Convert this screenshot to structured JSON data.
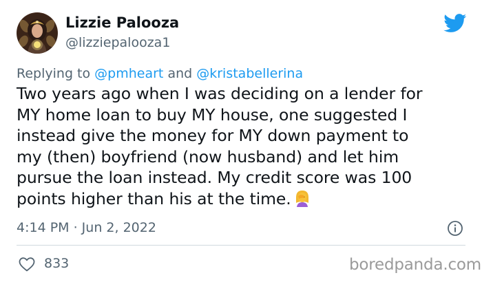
{
  "author": {
    "display_name": "Lizzie Palooza",
    "handle": "@lizziepalooza1",
    "avatar_icon": "profile-avatar"
  },
  "platform_icon": "twitter-bird-icon",
  "reply_context": {
    "prefix": "Replying to",
    "mention_1": "@pmheart",
    "joiner": "and",
    "mention_2": "@kristabellerina"
  },
  "tweet": {
    "lines": [
      "Two years ago when I was deciding on a lender for",
      "MY home loan to buy MY house, one suggested I",
      "instead give the money for MY down payment to",
      "my (then) boyfriend (now husband) and let him",
      "pursue the loan instead. My credit score was 100",
      "points higher than his at the time."
    ],
    "emoji": "woman-facepalming-emoji"
  },
  "meta": {
    "timestamp": "4:14 PM · Jun 2, 2022",
    "info_icon": "info-icon"
  },
  "actions": {
    "like_icon": "heart-icon",
    "like_count": "833"
  },
  "watermark": "boredpanda.com",
  "colors": {
    "text_primary": "#0f1419",
    "text_secondary": "#536471",
    "accent": "#1d9bf0",
    "divider": "#cfd9de"
  }
}
